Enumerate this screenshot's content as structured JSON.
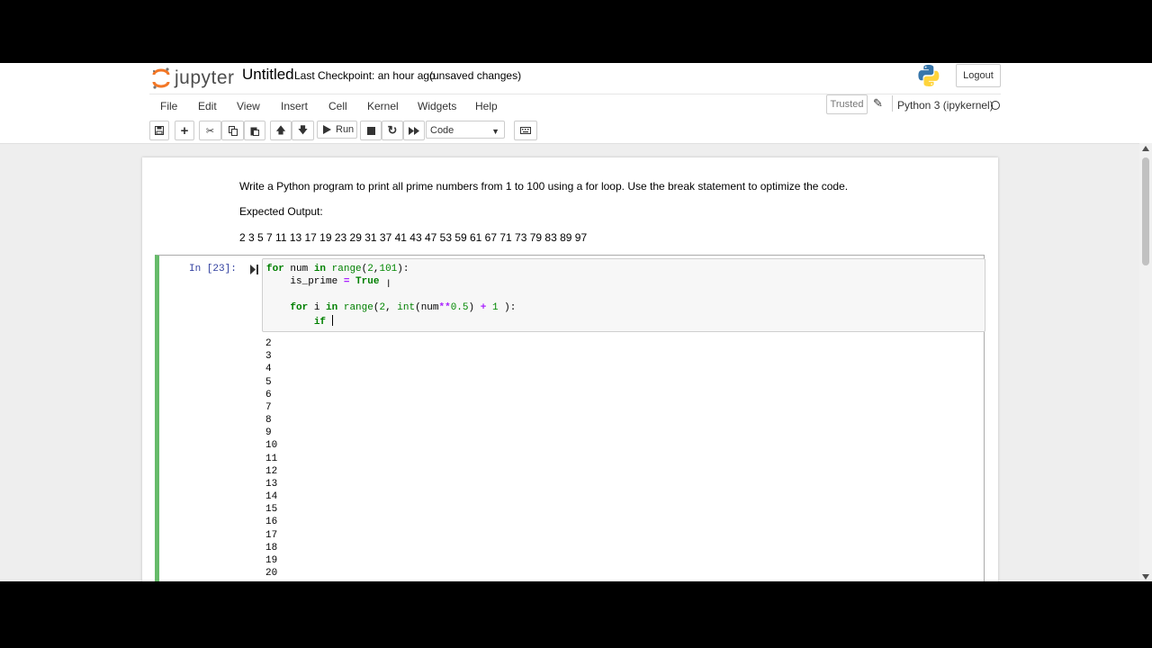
{
  "header": {
    "logo_text": "jupyter",
    "notebook_name": "Untitled",
    "checkpoint": "Last Checkpoint: an hour ago",
    "unsaved": "(unsaved changes)",
    "logout_label": "Logout"
  },
  "menu": [
    "File",
    "Edit",
    "View",
    "Insert",
    "Cell",
    "Kernel",
    "Widgets",
    "Help"
  ],
  "trusted_label": "Trusted",
  "kernel_name": "Python 3 (ipykernel)",
  "toolbar": {
    "run_label": "Run",
    "cell_type": "Code"
  },
  "markdown": {
    "task": "Write a Python program to print all prime numbers from 1 to 100 using a for loop. Use the break statement to optimize the code.",
    "expected_label": "Expected Output:",
    "expected_values": "2 3 5 7 11 13 17 19 23 29 31 37 41 43 47 53 59 61 67 71 73 79 83 89 97"
  },
  "cell": {
    "prompt": "In [23]:",
    "output": [
      "2",
      "3",
      "4",
      "5",
      "6",
      "7",
      "8",
      "9",
      "10",
      "11",
      "12",
      "13",
      "14",
      "15",
      "16",
      "17",
      "18",
      "19",
      "20"
    ]
  },
  "colors": {
    "cell_border_active": "#66bb6a",
    "prompt": "#303f9f",
    "keyword": "#008000"
  }
}
